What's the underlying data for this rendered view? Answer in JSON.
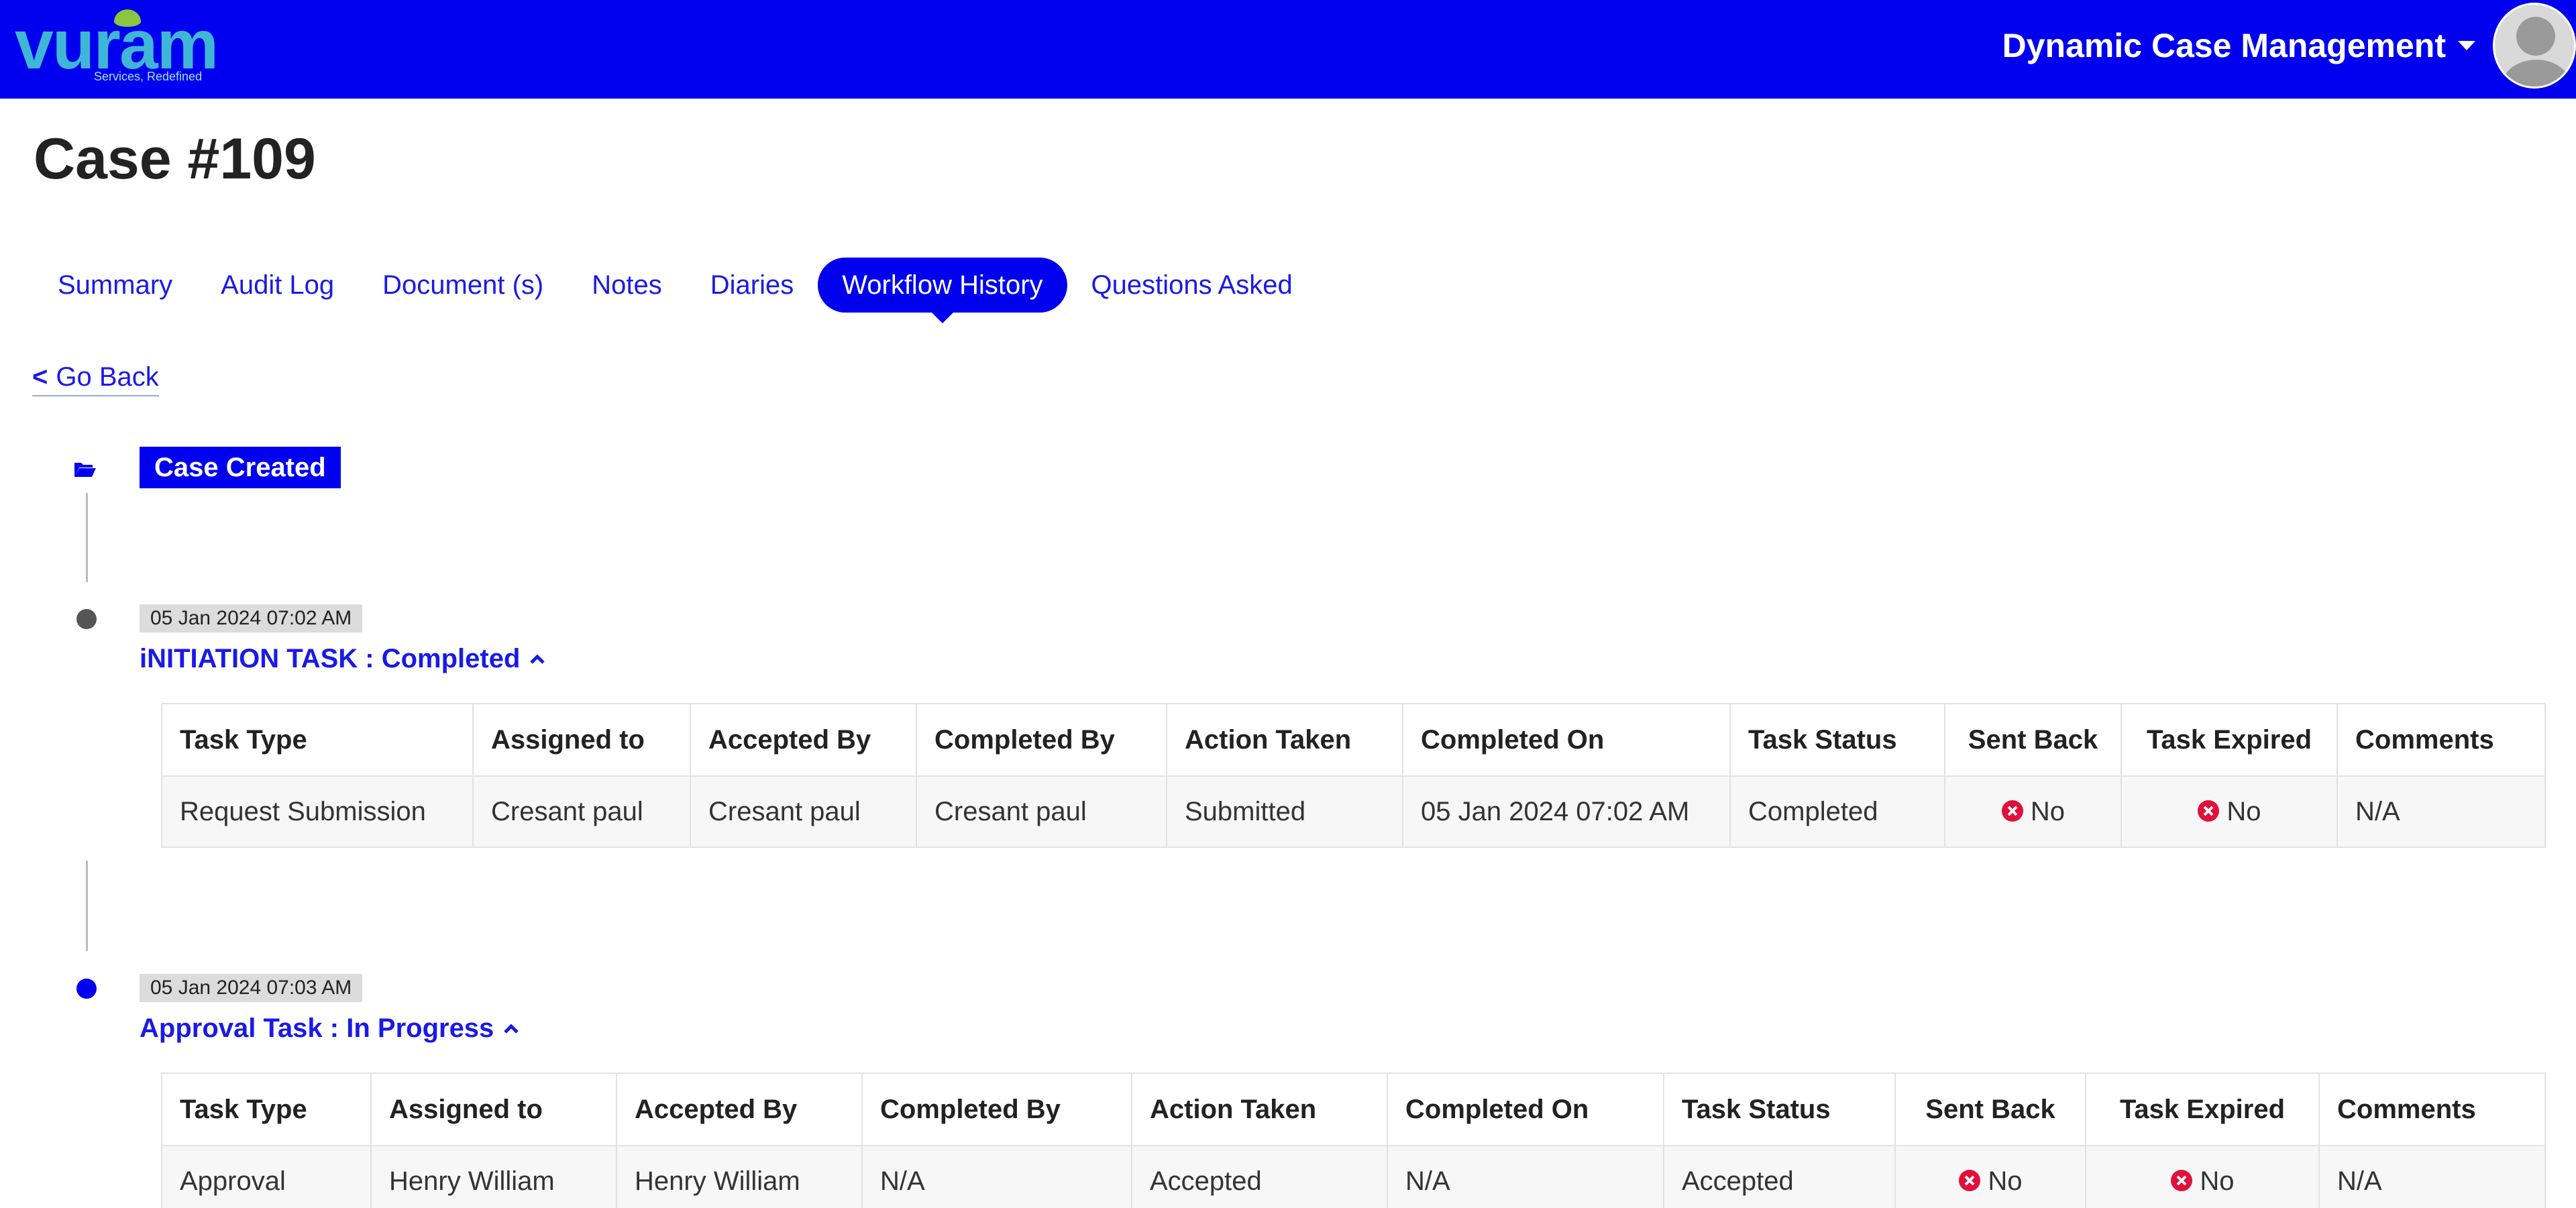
{
  "header": {
    "logo_text": "vuram",
    "logo_tagline": "Services, Redefined",
    "app_menu_label": "Dynamic Case Management"
  },
  "page": {
    "title": "Case #109"
  },
  "tabs": [
    {
      "label": "Summary",
      "active": false
    },
    {
      "label": "Audit Log",
      "active": false
    },
    {
      "label": "Document (s)",
      "active": false
    },
    {
      "label": "Notes",
      "active": false
    },
    {
      "label": "Diaries",
      "active": false
    },
    {
      "label": "Workflow History",
      "active": true
    },
    {
      "label": "Questions Asked",
      "active": false
    }
  ],
  "go_back": {
    "chevron": "<",
    "label": "Go Back"
  },
  "timeline": {
    "start_label": "Case Created",
    "start_icon": "folder-open-icon",
    "tasks": [
      {
        "timestamp": "05 Jan 2024 07:02 AM",
        "heading": "iNITIATION TASK : Completed",
        "dot_color": "#555555",
        "columns": [
          "Task Type",
          "Assigned to",
          "Accepted By",
          "Completed By",
          "Action Taken",
          "Completed On",
          "Task Status",
          "Sent Back",
          "Task Expired",
          "Comments"
        ],
        "row": {
          "task_type": "Request Submission",
          "assigned_to": "Cresant paul",
          "accepted_by": "Cresant paul",
          "completed_by": "Cresant paul",
          "action_taken": "Submitted",
          "completed_on": "05 Jan 2024 07:02 AM",
          "task_status": "Completed",
          "sent_back": "No",
          "task_expired": "No",
          "comments": "N/A"
        }
      },
      {
        "timestamp": "05 Jan 2024 07:03 AM",
        "heading": "Approval Task : In Progress",
        "dot_color": "#0000ee",
        "columns": [
          "Task Type",
          "Assigned to",
          "Accepted By",
          "Completed By",
          "Action Taken",
          "Completed On",
          "Task Status",
          "Sent Back",
          "Task Expired",
          "Comments"
        ],
        "row": {
          "task_type": "Approval",
          "assigned_to": "Henry William",
          "accepted_by": "Henry William",
          "completed_by": "N/A",
          "action_taken": "Accepted",
          "completed_on": "N/A",
          "task_status": "Accepted",
          "sent_back": "No",
          "task_expired": "No",
          "comments": "N/A"
        }
      }
    ]
  },
  "colors": {
    "brand_blue": "#0000ee",
    "link_blue": "#1a1ae6",
    "no_icon_red": "#e0103a"
  }
}
